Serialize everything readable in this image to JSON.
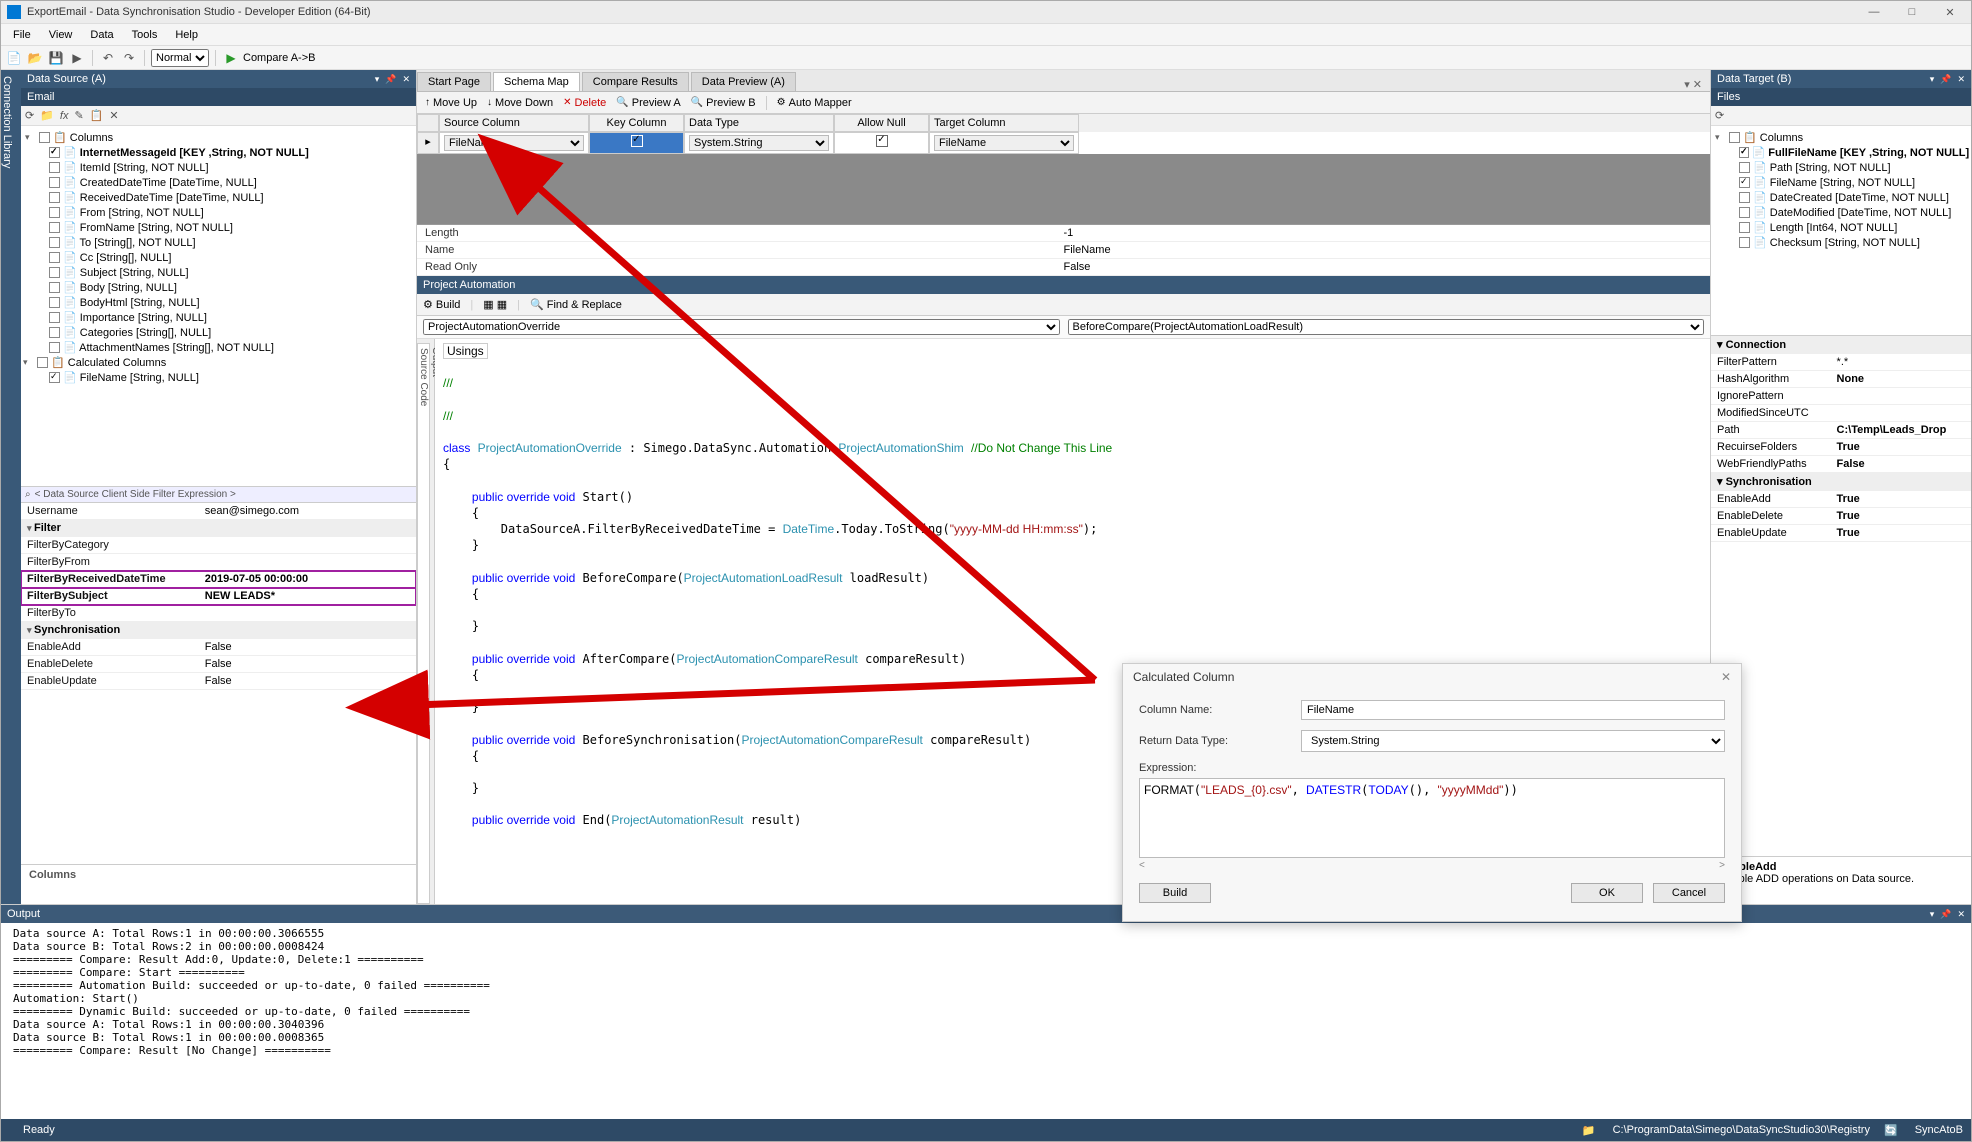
{
  "window": {
    "title": "ExportEmail - Data Synchronisation Studio - Developer Edition (64-Bit)"
  },
  "menu": [
    "File",
    "View",
    "Data",
    "Tools",
    "Help"
  ],
  "toolbar": {
    "mode": "Normal",
    "compare": "Compare A->B"
  },
  "sidebar_tab": "Connection Library",
  "panels": {
    "left": {
      "title": "Data Source (A)",
      "sub": "Email"
    },
    "right": {
      "title": "Data Target (B)",
      "sub": "Files"
    }
  },
  "left_tree": {
    "root": "Columns",
    "items": [
      {
        "label": "InternetMessageId [KEY ,String, NOT NULL]",
        "checked": true,
        "bold": true
      },
      {
        "label": "ItemId [String, NOT NULL]"
      },
      {
        "label": "CreatedDateTime [DateTime, NULL]"
      },
      {
        "label": "ReceivedDateTime [DateTime, NULL]"
      },
      {
        "label": "From [String, NOT NULL]"
      },
      {
        "label": "FromName [String, NOT NULL]"
      },
      {
        "label": "To [String[], NOT NULL]"
      },
      {
        "label": "Cc [String[], NULL]"
      },
      {
        "label": "Subject [String, NULL]"
      },
      {
        "label": "Body [String, NULL]"
      },
      {
        "label": "BodyHtml [String, NULL]"
      },
      {
        "label": "Importance [String, NULL]"
      },
      {
        "label": "Categories [String[], NULL]"
      },
      {
        "label": "AttachmentNames [String[], NOT NULL]"
      }
    ],
    "calc_root": "Calculated Columns",
    "calc_items": [
      {
        "label": "FileName [String, NULL]",
        "checked": true
      }
    ]
  },
  "propgrid": {
    "filter_text": "< Data Source Client Side Filter Expression >",
    "rows": [
      {
        "k": "Username",
        "v": "sean@simego.com"
      }
    ],
    "filter_cat": "Filter",
    "filter_rows": [
      {
        "k": "FilterByCategory",
        "v": ""
      },
      {
        "k": "FilterByFrom",
        "v": ""
      },
      {
        "k": "FilterByReceivedDateTime",
        "v": "2019-07-05 00:00:00",
        "hl": true,
        "bold": true
      },
      {
        "k": "FilterBySubject",
        "v": "NEW LEADS*",
        "hl": true,
        "bold": true
      },
      {
        "k": "FilterByTo",
        "v": ""
      }
    ],
    "sync_cat": "Synchronisation",
    "sync_rows": [
      {
        "k": "EnableAdd",
        "v": "False"
      },
      {
        "k": "EnableDelete",
        "v": "False"
      },
      {
        "k": "EnableUpdate",
        "v": "False"
      }
    ],
    "desc_title": "Columns"
  },
  "tabs": [
    "Start Page",
    "Schema Map",
    "Compare Results",
    "Data Preview (A)"
  ],
  "tabs_active": 1,
  "actions": [
    {
      "ico": "↑",
      "label": "Move Up"
    },
    {
      "ico": "↓",
      "label": "Move Down"
    },
    {
      "ico": "✕",
      "label": "Delete",
      "color": "#c00"
    },
    {
      "ico": "🔍",
      "label": "Preview A"
    },
    {
      "ico": "🔍",
      "label": "Preview B"
    },
    {
      "ico": "⚙",
      "label": "Auto Mapper"
    }
  ],
  "schema": {
    "headers": [
      "Source Column",
      "Key Column",
      "Data Type",
      "Allow Null",
      "Target Column"
    ],
    "row": {
      "src": "FileName",
      "key": true,
      "type": "System.String",
      "null": true,
      "tgt": "FileName"
    },
    "details": [
      {
        "k": "Length",
        "v": "-1"
      },
      {
        "k": "Name",
        "v": "FileName"
      },
      {
        "k": "Read Only",
        "v": "False"
      }
    ]
  },
  "pa": {
    "title": "Project Automation",
    "toolbar": {
      "build": "Build",
      "find": "Find & Replace"
    },
    "dd1": "ProjectAutomationOverride",
    "dd2": "BeforeCompare(ProjectAutomationLoadResult)",
    "code_tabs": [
      "Source Code",
      "Output"
    ]
  },
  "code": {
    "l1": "Usings",
    "c1": "/// <summary>",
    "c2": "/// </summary>",
    "cls": "class ProjectAutomationOverride : Simego.DataSync.Automation.ProjectAutomationShim ",
    "cls_cm": "//Do Not Change This Line",
    "m1_sig": "public override void Start()",
    "m1_body": "        DataSourceA.FilterByReceivedDateTime = DateTime.Today.ToString(\"yyyy-MM-dd HH:mm:ss\");",
    "m2_sig": "public override void BeforeCompare(ProjectAutomationLoadResult loadResult)",
    "m3_sig": "public override void AfterCompare(ProjectAutomationCompareResult compareResult)",
    "m4_sig": "public override void BeforeSynchronisation(ProjectAutomationCompareResult compareResult)",
    "m5_sig": "public override void End(ProjectAutomationResult result)"
  },
  "right_tree": {
    "root": "Columns",
    "items": [
      {
        "label": "FullFileName [KEY ,String, NOT NULL]",
        "checked": true,
        "bold": true
      },
      {
        "label": "Path [String, NOT NULL]"
      },
      {
        "label": "FileName [String, NOT NULL]",
        "checked": true
      },
      {
        "label": "DateCreated [DateTime, NOT NULL]"
      },
      {
        "label": "DateModified [DateTime, NOT NULL]"
      },
      {
        "label": "Length [Int64, NOT NULL]"
      },
      {
        "label": "Checksum [String, NOT NULL]"
      }
    ]
  },
  "conn": {
    "cat": "Connection",
    "rows": [
      {
        "k": "FilterPattern",
        "v": "*.*"
      },
      {
        "k": "HashAlgorithm",
        "v": "None",
        "bold": true
      },
      {
        "k": "IgnorePattern",
        "v": ""
      },
      {
        "k": "ModifiedSinceUTC",
        "v": ""
      },
      {
        "k": "Path",
        "v": "C:\\Temp\\Leads_Drop",
        "bold": true
      },
      {
        "k": "RecuirseFolders",
        "v": "True",
        "bold": true
      },
      {
        "k": "WebFriendlyPaths",
        "v": "False",
        "bold": true
      }
    ],
    "sync_cat": "Synchronisation",
    "sync_rows": [
      {
        "k": "EnableAdd",
        "v": "True",
        "bold": true
      },
      {
        "k": "EnableDelete",
        "v": "True",
        "bold": true
      },
      {
        "k": "EnableUpdate",
        "v": "True",
        "bold": true
      }
    ],
    "desc_title": "EnableAdd",
    "desc_body": "Enable ADD operations on Data source."
  },
  "output": {
    "title": "Output",
    "lines": [
      "Data source A: Total Rows:1 in 00:00:00.3066555",
      "Data source B: Total Rows:2 in 00:00:00.0008424",
      "========= Compare: Result Add:0, Update:0, Delete:1 ==========",
      "========= Compare: Start ==========",
      "========= Automation Build: succeeded or up-to-date, 0 failed ==========",
      "Automation: Start()",
      "========= Dynamic Build: succeeded or up-to-date, 0 failed ==========",
      "Data source A: Total Rows:1 in 00:00:00.3040396",
      "Data source B: Total Rows:1 in 00:00:00.0008365",
      "========= Compare: Result [No Change] =========="
    ]
  },
  "status": {
    "ready": "Ready",
    "path": "C:\\ProgramData\\Simego\\DataSyncStudio30\\Registry",
    "sync": "SyncAtoB"
  },
  "dialog": {
    "title": "Calculated Column",
    "column_name_label": "Column Name:",
    "column_name": "FileName",
    "return_type_label": "Return Data Type:",
    "return_type": "System.String",
    "expr_label": "Expression:",
    "expr_fn": "FORMAT",
    "expr_s1": "\"LEADS_{0}.csv\"",
    "expr_fn2": "DATESTR",
    "expr_fn3": "TODAY",
    "expr_s2": "\"yyyyMMdd\"",
    "build": "Build",
    "ok": "OK",
    "cancel": "Cancel"
  }
}
